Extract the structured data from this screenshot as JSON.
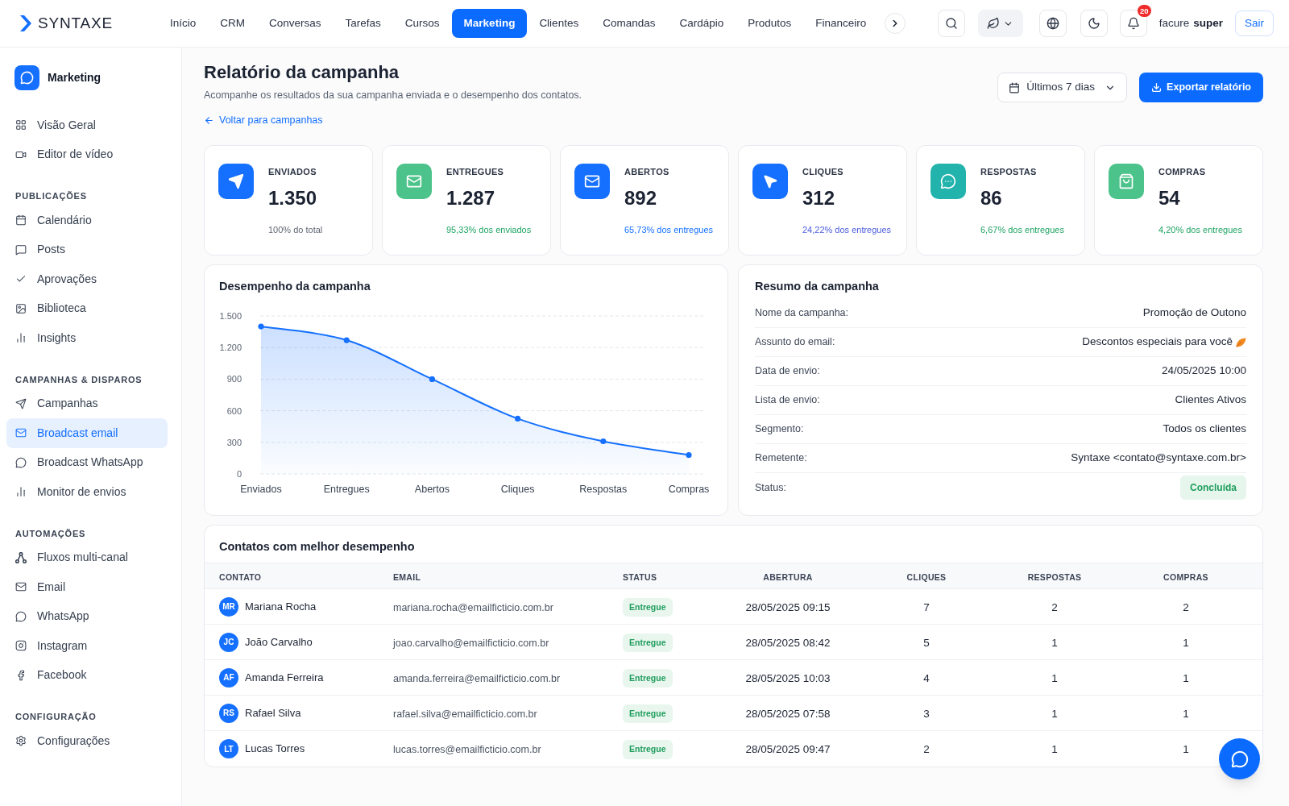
{
  "brand": {
    "name": "SYNTAXE"
  },
  "nav": {
    "items": [
      {
        "label": "Início",
        "selected": false
      },
      {
        "label": "CRM",
        "selected": false
      },
      {
        "label": "Conversas",
        "selected": false
      },
      {
        "label": "Tarefas",
        "selected": false
      },
      {
        "label": "Cursos",
        "selected": false
      },
      {
        "label": "Marketing",
        "selected": true
      },
      {
        "label": "Clientes",
        "selected": false
      },
      {
        "label": "Comandas",
        "selected": false
      },
      {
        "label": "Cardápio",
        "selected": false
      },
      {
        "label": "Produtos",
        "selected": false
      },
      {
        "label": "Financeiro",
        "selected": false
      }
    ]
  },
  "header_actions": {
    "notifications_count": "20",
    "user_name": "facure",
    "user_role": "super",
    "logout_label": "Sair"
  },
  "sidebar": {
    "title": "Marketing",
    "groups": [
      {
        "items": [
          {
            "label": "Visão Geral",
            "selected": false
          },
          {
            "label": "Editor de vídeo",
            "selected": false
          }
        ]
      },
      {
        "heading": "PUBLICAÇÕES",
        "items": [
          {
            "label": "Calendário",
            "selected": false
          },
          {
            "label": "Posts",
            "selected": false
          },
          {
            "label": "Aprovações",
            "selected": false
          },
          {
            "label": "Biblioteca",
            "selected": false
          },
          {
            "label": "Insights",
            "selected": false
          }
        ]
      },
      {
        "heading": "CAMPANHAS & DISPAROS",
        "items": [
          {
            "label": "Campanhas",
            "selected": false
          },
          {
            "label": "Broadcast email",
            "selected": true
          },
          {
            "label": "Broadcast WhatsApp",
            "selected": false
          },
          {
            "label": "Monitor de envios",
            "selected": false
          }
        ]
      },
      {
        "heading": "AUTOMAÇÕES",
        "items": [
          {
            "label": "Fluxos multi-canal",
            "selected": false
          },
          {
            "label": "Email",
            "selected": false
          },
          {
            "label": "WhatsApp",
            "selected": false
          },
          {
            "label": "Instagram",
            "selected": false
          },
          {
            "label": "Facebook",
            "selected": false
          }
        ]
      },
      {
        "heading": "CONFIGURAÇÃO",
        "items": [
          {
            "label": "Configurações",
            "selected": false
          }
        ]
      }
    ]
  },
  "page": {
    "title": "Relatório da campanha",
    "subtitle": "Acompanhe os resultados da sua campanha enviada e o desempenho dos contatos.",
    "back_link": "Voltar para campanhas",
    "period": "Últimos 7 dias",
    "export_label": "Exportar relatório"
  },
  "stats": [
    {
      "label": "ENVIADOS",
      "value": "1.350",
      "color": "#1570ff",
      "note": {
        "text": "100% do total",
        "color": "#5f6673"
      }
    },
    {
      "label": "ENTREGUES",
      "value": "1.287",
      "color": "#4cc38a",
      "note": {
        "text": "95,33% dos enviados",
        "color": "#1fa463"
      }
    },
    {
      "label": "ABERTOS",
      "value": "892",
      "color": "#1570ff",
      "note": {
        "text": "65,73% dos entregues",
        "color": "#1570ff"
      }
    },
    {
      "label": "CLIQUES",
      "value": "312",
      "color": "#1570ff",
      "note": {
        "text": "24,22% dos entregues",
        "color": "#4b5bdc"
      }
    },
    {
      "label": "RESPOSTAS",
      "value": "86",
      "color": "#22b3ad",
      "note": {
        "text": "6,67% dos entregues",
        "color": "#1fa463"
      }
    },
    {
      "label": "COMPRAS",
      "value": "54",
      "color": "#4cc38a",
      "note": {
        "text": "4,20% dos entregues",
        "color": "#1fa463"
      }
    }
  ],
  "performance": {
    "chart_data": {
      "type": "area",
      "title": "Desempenho da campanha",
      "categories": [
        "Enviados",
        "Entregues",
        "Abertos",
        "Cliques",
        "Respostas",
        "Compras"
      ],
      "values": [
        1400,
        1270,
        900,
        525,
        310,
        180
      ],
      "ylim": [
        0,
        1500
      ],
      "yticks": [
        {
          "value": 0,
          "label": "0"
        },
        {
          "value": 300,
          "label": "300"
        },
        {
          "value": 600,
          "label": "600"
        },
        {
          "value": 900,
          "label": "900"
        },
        {
          "value": 1200,
          "label": "1.200"
        },
        {
          "value": 1500,
          "label": "1.500"
        }
      ],
      "grid": true
    }
  },
  "summary": {
    "title": "Resumo da campanha",
    "rows": [
      {
        "label": "Nome da campanha:",
        "value": "Promoção de Outono",
        "kind": "text"
      },
      {
        "label": "Assunto do email:",
        "value": "Descontos especiais para você",
        "kind": "decorated"
      },
      {
        "label": "Data de envio:",
        "value": "24/05/2025 10:00",
        "kind": "text"
      },
      {
        "label": "Lista de envio:",
        "value": "Clientes Ativos",
        "kind": "text"
      },
      {
        "label": "Segmento:",
        "value": "Todos os clientes",
        "kind": "text"
      },
      {
        "label": "Remetente:",
        "value": "Syntaxe <contato@syntaxe.com.br>",
        "kind": "text"
      },
      {
        "label": "Status:",
        "value": "Concluída",
        "kind": "badge"
      }
    ]
  },
  "top_contacts": {
    "title": "Contatos com melhor desempenho",
    "columns": [
      "CONTATO",
      "EMAIL",
      "STATUS",
      "ABERTURA",
      "CLIQUES",
      "RESPOSTAS",
      "COMPRAS"
    ],
    "rows": [
      {
        "initials": "MR",
        "name": "Mariana Rocha",
        "email": "mariana.rocha@emailficticio.com.br",
        "status": "Entregue",
        "opened_at": "28/05/2025 09:15",
        "clicks": "7",
        "replies": "2",
        "purchases": "2"
      },
      {
        "initials": "JC",
        "name": "João Carvalho",
        "email": "joao.carvalho@emailficticio.com.br",
        "status": "Entregue",
        "opened_at": "28/05/2025 08:42",
        "clicks": "5",
        "replies": "1",
        "purchases": "1"
      },
      {
        "initials": "AF",
        "name": "Amanda Ferreira",
        "email": "amanda.ferreira@emailficticio.com.br",
        "status": "Entregue",
        "opened_at": "28/05/2025 10:03",
        "clicks": "4",
        "replies": "1",
        "purchases": "1"
      },
      {
        "initials": "RS",
        "name": "Rafael Silva",
        "email": "rafael.silva@emailficticio.com.br",
        "status": "Entregue",
        "opened_at": "28/05/2025 07:58",
        "clicks": "3",
        "replies": "1",
        "purchases": "1"
      },
      {
        "initials": "LT",
        "name": "Lucas Torres",
        "email": "lucas.torres@emailficticio.com.br",
        "status": "Entregue",
        "opened_at": "28/05/2025 09:47",
        "clicks": "2",
        "replies": "1",
        "purchases": "1"
      }
    ]
  }
}
